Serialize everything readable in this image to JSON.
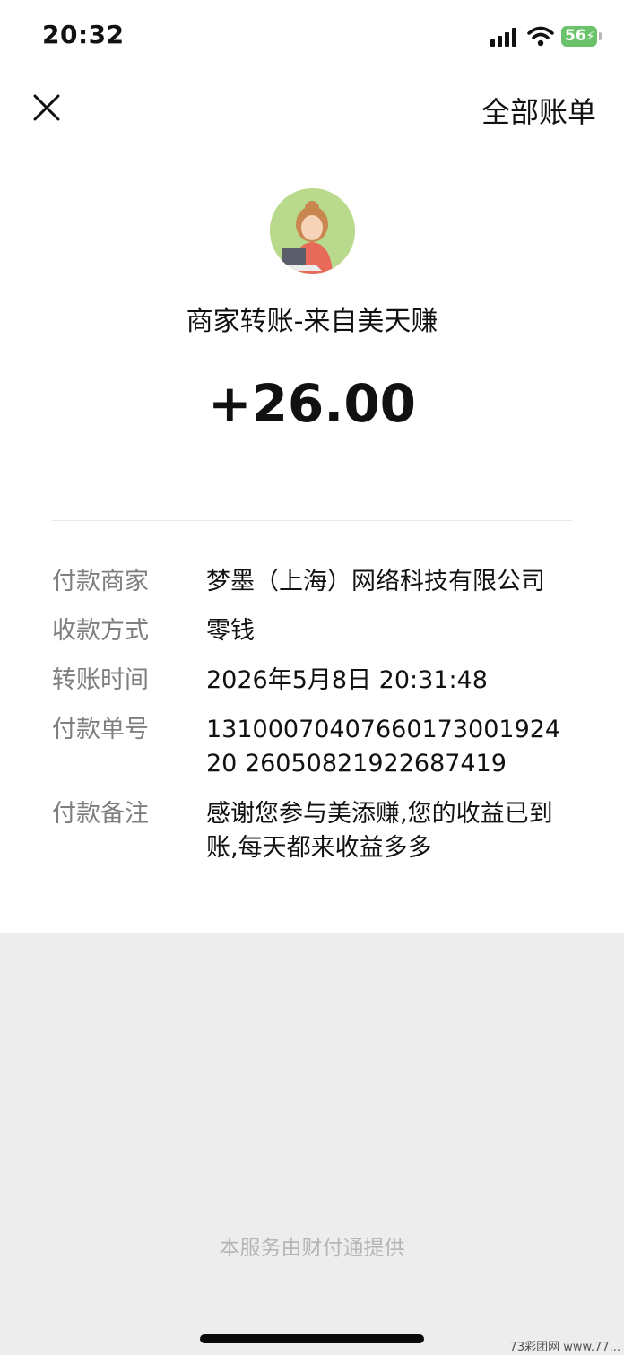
{
  "status_bar": {
    "time": "20:32",
    "battery": "56"
  },
  "nav": {
    "right_action": "全部账单"
  },
  "header": {
    "title": "商家转账-来自美天赚",
    "amount": "+26.00"
  },
  "details": [
    {
      "label": "付款商家",
      "value": "梦墨（上海）网络科技有限公司"
    },
    {
      "label": "收款方式",
      "value": "零钱"
    },
    {
      "label": "转账时间",
      "value": "2026年5月8日 20:31:48"
    },
    {
      "label": "付款单号",
      "value": "1310007040766017300192420 26050821922687419"
    },
    {
      "label": "付款备注",
      "value": "感谢您参与美添赚,您的收益已到账,每天都来收益多多"
    }
  ],
  "footer": "本服务由财付通提供",
  "watermark": "73彩团网 www.77...",
  "icons": {
    "close": "close-icon",
    "signal": "cellular-signal-icon",
    "wifi": "wifi-icon",
    "battery": "battery-charging-icon"
  },
  "colors": {
    "amount": "#111111",
    "label": "#7f7f7f",
    "footer": "#b5b5b5",
    "battery": "#6ac36a"
  }
}
